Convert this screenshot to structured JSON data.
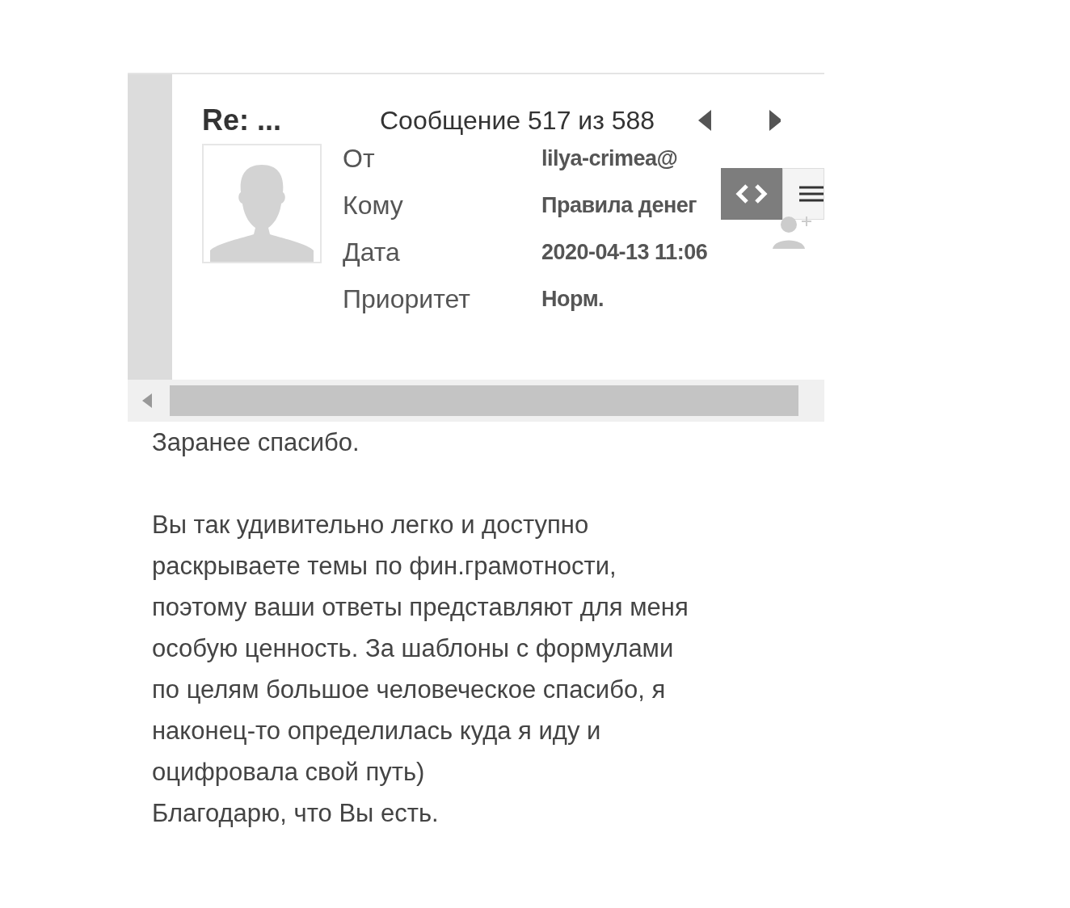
{
  "message": {
    "subject": "Re: ...",
    "counter": "Сообщение 517 из 588"
  },
  "fields": [
    {
      "label": "От",
      "value": "lilya-crimea@"
    },
    {
      "label": "Кому",
      "value": "Правила денег"
    },
    {
      "label": "Дата",
      "value": "2020-04-13 11:06"
    },
    {
      "label": "Приоритет",
      "value": "Норм."
    }
  ],
  "body": [
    [
      "Заранее спасибо."
    ],
    [
      "Вы так удивительно легко и доступно",
      "раскрываете темы по фин.грамотности,",
      "поэтому ваши ответы представляют для меня",
      "особую ценность. За шаблоны с формулами",
      "по целям большое человеческое спасибо, я",
      "наконец-то определилась куда я иду и",
      "оцифровала свой путь)",
      "Благодарю, что Вы есть."
    ]
  ]
}
